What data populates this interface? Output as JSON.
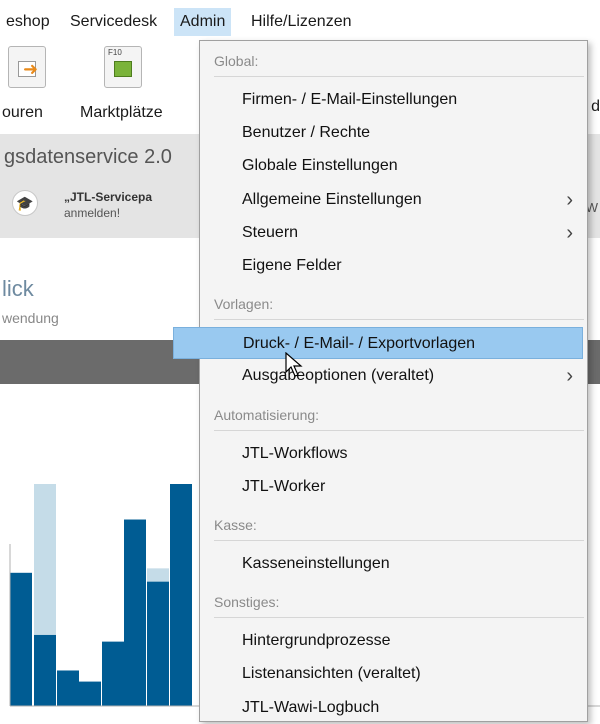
{
  "menubar": {
    "items": [
      {
        "label": "eshop",
        "active": false
      },
      {
        "label": "Servicedesk",
        "active": false
      },
      {
        "label": "Admin",
        "active": true
      },
      {
        "label": "Hilfe/Lizenzen",
        "active": false
      }
    ]
  },
  "ribbon": {
    "labels": [
      "ouren",
      "Marktplätze"
    ],
    "icon_fkey": "F10",
    "trailing": "d"
  },
  "band": {
    "title": "gsdatenservice 2.0",
    "promo_title": "„JTL-Servicepa",
    "promo_sub": "anmelden!",
    "trailing": "W"
  },
  "overview": {
    "title": "lick",
    "subtitle": "wendung"
  },
  "dropdown": {
    "sections": [
      {
        "title": "Global:",
        "items": [
          {
            "label": "Firmen- / E-Mail-Einstellungen",
            "has_submenu": false
          },
          {
            "label": "Benutzer / Rechte",
            "has_submenu": false
          },
          {
            "label": "Globale Einstellungen",
            "has_submenu": false
          },
          {
            "label": "Allgemeine Einstellungen",
            "has_submenu": true
          },
          {
            "label": "Steuern",
            "has_submenu": true
          },
          {
            "label": "Eigene Felder",
            "has_submenu": false
          }
        ]
      },
      {
        "title": "Vorlagen:",
        "items": [
          {
            "label": "Druck- / E-Mail- / Exportvorlagen",
            "has_submenu": false,
            "highlighted": true
          },
          {
            "label": "Ausgabeoptionen (veraltet)",
            "has_submenu": true
          }
        ]
      },
      {
        "title": "Automatisierung:",
        "items": [
          {
            "label": "JTL-Workflows",
            "has_submenu": false
          },
          {
            "label": "JTL-Worker",
            "has_submenu": false
          }
        ]
      },
      {
        "title": "Kasse:",
        "items": [
          {
            "label": "Kasseneinstellungen",
            "has_submenu": false
          }
        ]
      },
      {
        "title": "Sonstiges:",
        "items": [
          {
            "label": "Hintergrundprozesse",
            "has_submenu": false
          },
          {
            "label": "Listenansichten (veraltet)",
            "has_submenu": false
          },
          {
            "label": "JTL-Wawi-Logbuch",
            "has_submenu": false
          }
        ]
      }
    ],
    "submenu_icon": "chevron-right-icon",
    "highlight_color": "#99c9f0"
  },
  "chart_data": {
    "type": "bar",
    "note_visible_only_partially": true,
    "series": [
      {
        "color": "#005c93",
        "values": [
          60,
          32,
          16,
          11,
          29,
          84,
          56,
          100
        ]
      },
      {
        "color": "#c5dce8",
        "values": [
          0,
          100,
          0,
          0,
          0,
          0,
          62,
          0
        ]
      }
    ],
    "ylim": [
      0,
      100
    ]
  },
  "colors": {
    "accent": "#99c9f0",
    "menu_active": "#cce4f7",
    "bar_dark": "#005c93",
    "bar_light": "#c5dce8"
  }
}
